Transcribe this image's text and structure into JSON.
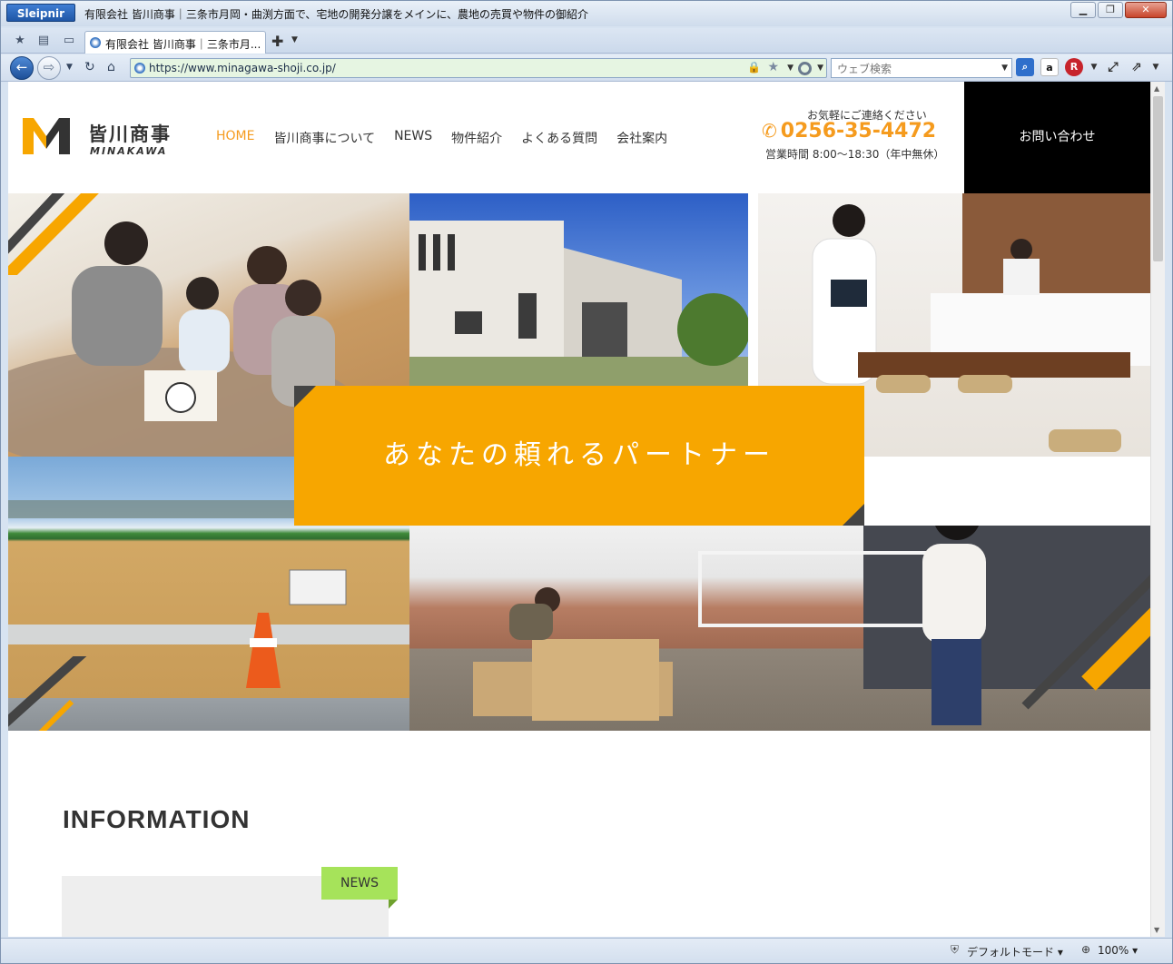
{
  "browser": {
    "app_name": "Sleipnir",
    "window_title": "有限会社 皆川商事｜三条市月岡・曲渕方面で、宅地の開発分譲をメインに、農地の売買や物件の御紹介",
    "tab_title": "有限会社 皆川商事｜三条市月...",
    "url": "https://www.minagawa-shoji.co.jp/",
    "search_placeholder": "ウェブ検索",
    "status_mode": "デフォルトモード",
    "zoom": "100%"
  },
  "site": {
    "logo_jp": "皆川商事",
    "logo_en": "MINAKAWA",
    "nav": [
      "HOME",
      "皆川商事について",
      "NEWS",
      "物件紹介",
      "よくある質問",
      "会社案内"
    ],
    "contact_note": "お気軽にご連絡ください",
    "phone": "0256-35-4472",
    "hours": "営業時間 8:00〜18:30（年中無休）",
    "contact_button": "お問い合わせ",
    "hero_catch": "あなたの頼れるパートナー",
    "info_title": "INFORMATION",
    "news_tag": "NEWS"
  },
  "colors": {
    "accent_orange": "#f7a600",
    "nav_active": "#f59b1e",
    "news_green": "#a6e35a",
    "contact_black": "#000000"
  }
}
